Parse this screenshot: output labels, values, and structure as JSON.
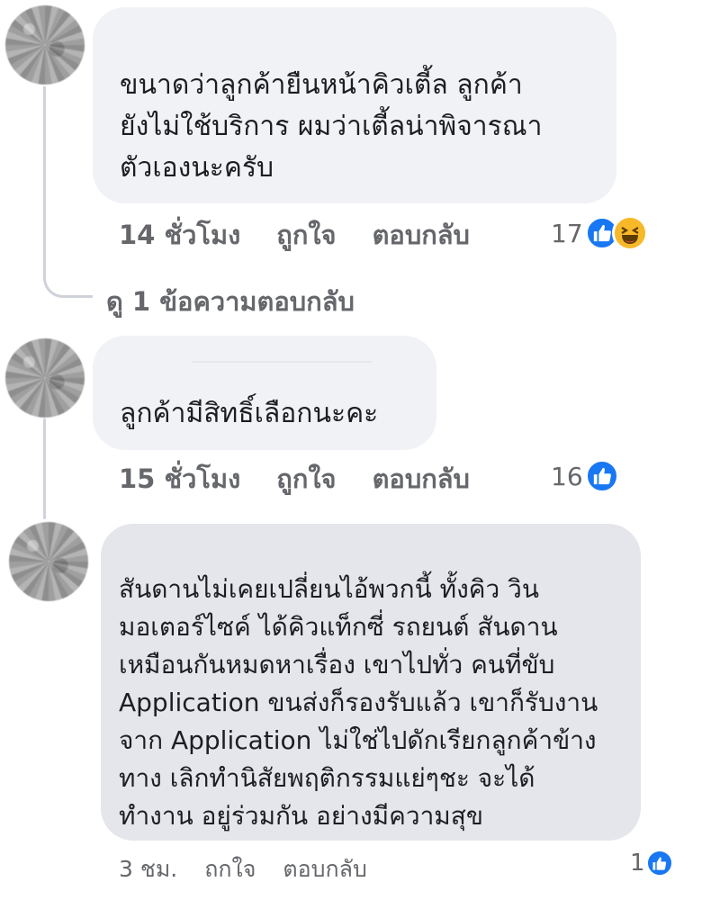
{
  "comments": [
    {
      "text": "ขนาดว่าลูกค้ายืนหน้าคิวเตี้ล ลูกค้า\nยังไม่ใช้บริการ ผมว่าเตี้ลน่าพิจารณา\nตัวเองนะครับ",
      "time": "14 ชั่วโมง",
      "like_label": "ถูกใจ",
      "reply_label": "ตอบกลับ",
      "reaction_count": "17",
      "reactions": [
        "like-icon",
        "haha-icon"
      ]
    },
    {
      "text": "ลูกค้ามีสิทธิ์เลือกนะคะ",
      "time": "15 ชั่วโมง",
      "like_label": "ถูกใจ",
      "reply_label": "ตอบกลับ",
      "reaction_count": "16",
      "reactions": [
        "like-icon"
      ]
    },
    {
      "text": "สันดานไม่เคยเปลี่ยนไอ้พวกนี้ ทั้งคิว วิน\nมอเตอร์ไซค์ ได้คิวแท็กซี่ รถยนต์ สันดาน\nเหมือนกันหมดหาเรื่อง เขาไปทั่ว คนที่ขับ\nApplication ขนส่งก็รองรับแล้ว เขาก็รับงาน\nจาก Application ไม่ใช่ไปดักเรียกลูกค้าข้าง\nทาง เลิกทำนิสัยพฤติกรรมแย่ๆชะ จะได้\nทำงาน อยู่ร่วมกัน อย่างมีความสุข",
      "time": "3 ชม.",
      "like_label": "ถกใจ",
      "reply_label": "ตอบกลับ",
      "reaction_count": "1",
      "reactions": [
        "like-icon"
      ]
    }
  ],
  "view_replies": "ดู 1 ข้อความตอบกลับ"
}
